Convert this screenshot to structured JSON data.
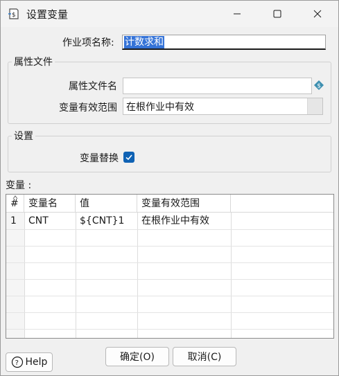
{
  "window": {
    "title": "设置变量"
  },
  "form": {
    "job_name_label": "作业项名称:",
    "job_name_value": "计数求和"
  },
  "properties_group": {
    "title": "属性文件",
    "file_name_label": "属性文件名",
    "file_name_value": "",
    "scope_label": "变量有效范围",
    "scope_value": "在根作业中有效"
  },
  "settings_group": {
    "title": "设置",
    "replace_label": "变量替换",
    "replace_checked": true
  },
  "variables": {
    "label": "变量 :",
    "columns": [
      "#",
      "变量名",
      "值",
      "变量有效范围"
    ],
    "rows": [
      {
        "num": "1",
        "name": "CNT",
        "value": "${CNT}1",
        "scope": "在根作业中有效"
      }
    ]
  },
  "buttons": {
    "ok": "确定(O)",
    "cancel": "取消(C)",
    "help": "Help"
  },
  "colors": {
    "accent": "#0f62b4",
    "selection": "#3573d7"
  }
}
